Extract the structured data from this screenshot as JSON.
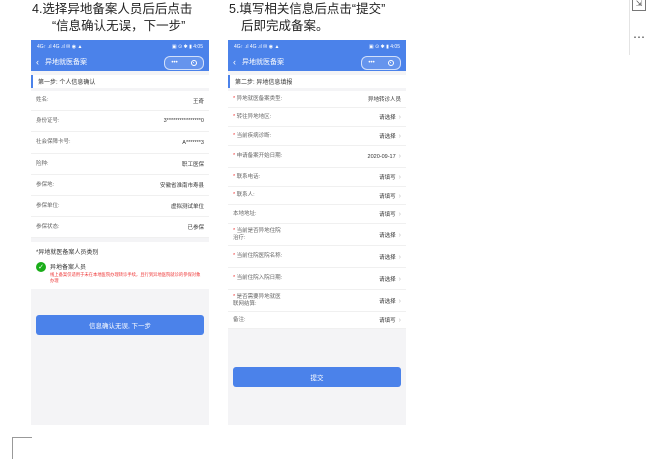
{
  "captions": {
    "step4_line1": "4.选择异地备案人员后后点击",
    "step4_line2": "“信息确认无误，下一步”",
    "step5_line1": "5.填写相关信息后点击“提交”",
    "step5_line2": "后即完成备案。"
  },
  "phone1": {
    "status_left": "4G↑ .ıl 4G .ıl ✉ ◉ ▲",
    "status_right": "▣ ⊙ ✱ ▮ 4:05",
    "nav_title": "异地就医备案",
    "step_title": "第一步: 个人信息确认",
    "rows": [
      {
        "label": "姓名:",
        "value": "王奇"
      },
      {
        "label": "身份证号:",
        "value": "3****************0"
      },
      {
        "label": "社会保障卡号:",
        "value": "A*******3"
      },
      {
        "label": "险种:",
        "value": "职工医保"
      },
      {
        "label": "参保地:",
        "value": "安徽省淮南市寿县"
      },
      {
        "label": "参保单位:",
        "value": "虚拟测试单位"
      },
      {
        "label": "参保状态:",
        "value": "已参保"
      }
    ],
    "category_title": "*异地就医备案人员类别",
    "option_title": "异地备案人员",
    "option_desc": "线上备案仅适用于未在本地医院办理转诊手续，且行到异地医院就诊的参保对象办理",
    "button_label": "信息确认无误, 下一步"
  },
  "phone2": {
    "status_left": "4G↑ .ıl 4G .ıl ✉ ◉ ▲",
    "status_right": "▣ ⊙ ✱ ▮ 4:05",
    "nav_title": "异地就医备案",
    "step_title": "第二步: 异地信息填报",
    "rows": [
      {
        "label": "异地就医备案类型:",
        "value": "异地转诊人员",
        "required": true,
        "chev": false
      },
      {
        "label": "转往异地地区:",
        "value": "请选择",
        "required": true,
        "chev": true
      },
      {
        "label": "当前疾病诊断:",
        "value": "请选择",
        "required": true,
        "chev": true
      },
      {
        "label": "申请备案开始日期:",
        "value": "2020-09-17",
        "required": true,
        "chev": true
      },
      {
        "label": "联系电话:",
        "value": "请填写",
        "required": true,
        "chev": true
      },
      {
        "label": "联系人:",
        "value": "请填写",
        "required": true,
        "chev": true
      },
      {
        "label": "本地地址:",
        "value": "请填写",
        "required": false,
        "chev": true
      },
      {
        "label": "当前是否异地住院治疗:",
        "value": "请选择",
        "required": true,
        "chev": true
      },
      {
        "label": "当前住院医院名称:",
        "value": "请选择",
        "required": true,
        "chev": true
      },
      {
        "label": "当前住院入院日期:",
        "value": "请选择",
        "required": true,
        "chev": true
      },
      {
        "label": "是否需要异地就医联网结算:",
        "value": "请选择",
        "required": true,
        "chev": true
      },
      {
        "label": "备注:",
        "value": "请填写",
        "required": false,
        "chev": true
      }
    ],
    "button_label": "提交"
  },
  "side": {
    "more_label": "⋯"
  }
}
